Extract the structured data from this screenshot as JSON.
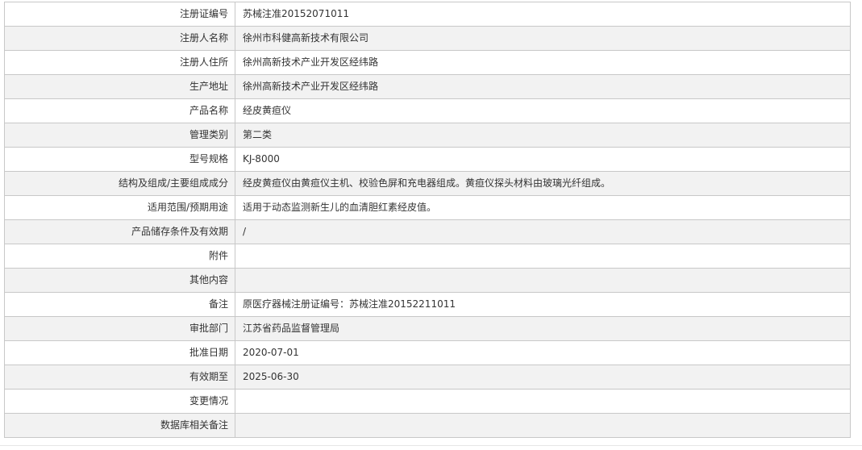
{
  "rows": [
    {
      "label": "注册证编号",
      "value": "苏械注准20152071011"
    },
    {
      "label": "注册人名称",
      "value": "徐州市科健高新技术有限公司"
    },
    {
      "label": "注册人住所",
      "value": "徐州高新技术产业开发区经纬路"
    },
    {
      "label": "生产地址",
      "value": "徐州高新技术产业开发区经纬路"
    },
    {
      "label": "产品名称",
      "value": "经皮黄疸仪"
    },
    {
      "label": "管理类别",
      "value": "第二类"
    },
    {
      "label": "型号规格",
      "value": "KJ-8000"
    },
    {
      "label": "结构及组成/主要组成成分",
      "value": "经皮黄疸仪由黄疸仪主机、校验色屏和充电器组成。黄疸仪探头材料由玻璃光纤组成。"
    },
    {
      "label": "适用范围/预期用途",
      "value": "适用于动态监测新生儿的血清胆红素经皮值。"
    },
    {
      "label": "产品储存条件及有效期",
      "value": "/"
    },
    {
      "label": "附件",
      "value": ""
    },
    {
      "label": "其他内容",
      "value": ""
    },
    {
      "label": "备注",
      "value": "原医疗器械注册证编号：苏械注准20152211011"
    },
    {
      "label": "审批部门",
      "value": "江苏省药品监督管理局"
    },
    {
      "label": "批准日期",
      "value": "2020-07-01"
    },
    {
      "label": "有效期至",
      "value": "2025-06-30"
    },
    {
      "label": "变更情况",
      "value": ""
    },
    {
      "label": "数据库相关备注",
      "value": ""
    }
  ]
}
